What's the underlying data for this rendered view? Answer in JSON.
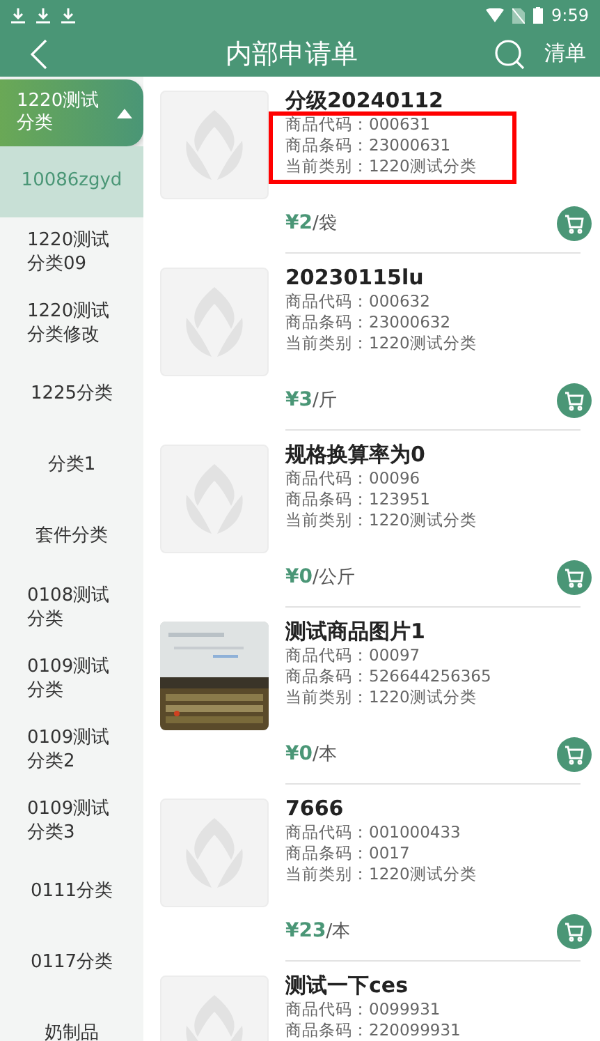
{
  "status_bar": {
    "time": "9:59"
  },
  "header": {
    "title": "内部申请单",
    "action": "清单"
  },
  "sidebar": {
    "group": {
      "label": "1220测试分类",
      "expanded": true
    },
    "items": [
      {
        "label": "10086zgyd",
        "selected": true
      },
      {
        "label": "1220测试分类09",
        "selected": false
      },
      {
        "label": "1220测试分类修改",
        "selected": false
      },
      {
        "label": "1225分类",
        "selected": false
      },
      {
        "label": "分类1",
        "selected": false
      },
      {
        "label": "套件分类",
        "selected": false
      },
      {
        "label": "0108测试分类",
        "selected": false
      },
      {
        "label": "0109测试分类",
        "selected": false
      },
      {
        "label": "0109测试分类2",
        "selected": false
      },
      {
        "label": "0109测试分类3",
        "selected": false
      },
      {
        "label": "0111分类",
        "selected": false
      },
      {
        "label": "0117分类",
        "selected": false
      },
      {
        "label": "奶制品",
        "selected": false
      }
    ]
  },
  "products": [
    {
      "name": "分级20240112",
      "kind": "placeholder",
      "highlighted": true,
      "details": [
        "商品代码：000631",
        "商品条码：23000631",
        "当前类别：1220测试分类"
      ],
      "price": "¥2",
      "unit": "/袋"
    },
    {
      "name": "20230115lu",
      "kind": "placeholder",
      "highlighted": false,
      "details": [
        "商品代码：000632",
        "商品条码：23000632",
        "当前类别：1220测试分类"
      ],
      "price": "¥3",
      "unit": "/斤"
    },
    {
      "name": "规格换算率为0",
      "kind": "placeholder",
      "highlighted": false,
      "details": [
        "商品代码：00096",
        "商品条码：123951",
        "当前类别：1220测试分类"
      ],
      "price": "¥0",
      "unit": "/公斤"
    },
    {
      "name": "测试商品图片1",
      "kind": "picture",
      "highlighted": false,
      "details": [
        "商品代码：00097",
        "商品条码：526644256365",
        "当前类别：1220测试分类"
      ],
      "price": "¥0",
      "unit": "/本"
    },
    {
      "name": "7666",
      "kind": "placeholder",
      "highlighted": false,
      "details": [
        "商品代码：001000433",
        "商品条码：0017",
        "当前类别：1220测试分类"
      ],
      "price": "¥23",
      "unit": "/本"
    },
    {
      "name": "测试一下ces",
      "kind": "placeholder",
      "highlighted": false,
      "details": [
        "商品代码：0099931",
        "商品条码：220099931"
      ]
    }
  ]
}
